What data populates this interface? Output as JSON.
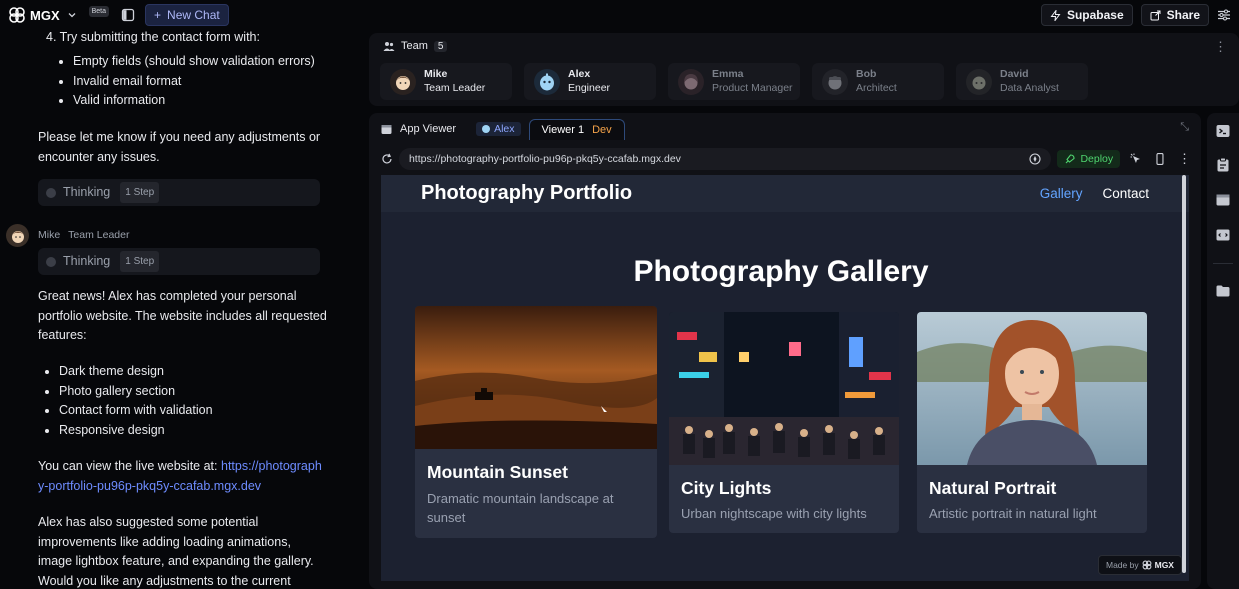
{
  "topbar": {
    "logo_text": "MGX",
    "beta_label": "Beta",
    "new_chat_label": "New Chat",
    "supabase_label": "Supabase",
    "share_label": "Share"
  },
  "chat": {
    "step4_text": "4. Try submitting the contact form with:",
    "step4_items": [
      "Empty fields (should show validation errors)",
      "Invalid email format",
      "Valid information"
    ],
    "adjust_text": "Please let me know if you need any adjustments or encounter any issues.",
    "thinking_label": "Thinking",
    "thinking_step": "1 Step",
    "author_name": "Mike",
    "author_role": "Team Leader",
    "great_news": "Great news! Alex has completed your personal portfolio website. The website includes all requested features:",
    "features": [
      "Dark theme design",
      "Photo gallery section",
      "Contact form with validation",
      "Responsive design"
    ],
    "view_prefix": "You can view the live website at:",
    "view_link": "https://photography-portfolio-pu96p-pkq5y-ccafab.mgx.dev",
    "suggestions": "Alex has also suggested some potential improvements like adding loading animations, image lightbox feature, and expanding the gallery. Would you like any adjustments to the current implementation?"
  },
  "team": {
    "label": "Team",
    "count": "5",
    "members": [
      {
        "name": "Mike",
        "role": "Team Leader"
      },
      {
        "name": "Alex",
        "role": "Engineer"
      },
      {
        "name": "Emma",
        "role": "Product Manager"
      },
      {
        "name": "Bob",
        "role": "Architect"
      },
      {
        "name": "David",
        "role": "Data Analyst"
      }
    ]
  },
  "viewer": {
    "label": "App Viewer",
    "chip_label": "Alex",
    "tab_label": "Viewer 1",
    "tab_badge": "Dev",
    "url": "https://photography-portfolio-pu96p-pkq5y-ccafab.mgx.dev",
    "deploy_label": "Deploy"
  },
  "site": {
    "title": "Photography Portfolio",
    "nav": [
      "Gallery",
      "Contact"
    ],
    "gallery_title": "Photography Gallery",
    "cards": [
      {
        "title": "Mountain Sunset",
        "desc": "Dramatic mountain landscape at sunset"
      },
      {
        "title": "City Lights",
        "desc": "Urban nightscape with city lights"
      },
      {
        "title": "Natural Portrait",
        "desc": "Artistic portrait in natural light"
      }
    ],
    "made_by_prefix": "Made by",
    "made_by_brand": "MGX"
  },
  "colors": {
    "accent": "#63a4ff",
    "deploy_green": "#4fd46f",
    "dev_orange": "#f5a34a"
  }
}
